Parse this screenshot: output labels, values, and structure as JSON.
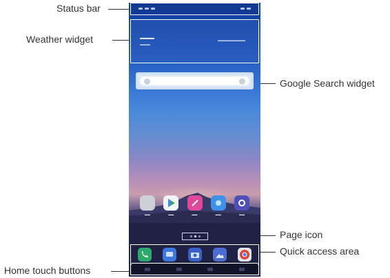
{
  "callouts": {
    "status_bar": "Status bar",
    "weather_widget": "Weather widget",
    "google_search_widget": "Google Search widget",
    "page_icon": "Page icon",
    "quick_access_area": "Quick access area",
    "home_touch_buttons": "Home touch buttons"
  },
  "colors": {
    "line": "#333333",
    "outline": "#ffffff",
    "wallpaper_top": "#0d3a9a",
    "wallpaper_bottom": "#23244a"
  },
  "apps": [
    {
      "icon": "gear-icon",
      "color": "#cfcfd6"
    },
    {
      "icon": "play-store-icon",
      "color": "#f2f4f8"
    },
    {
      "icon": "pen-icon",
      "color": "#e0499a"
    },
    {
      "icon": "camera-icon",
      "color": "#3d92e8"
    },
    {
      "icon": "settings-icon",
      "color": "#4f4fb8"
    }
  ],
  "quick_access": [
    {
      "icon": "phone-icon",
      "color": "#2fa96b"
    },
    {
      "icon": "messages-icon",
      "color": "#3d78e0"
    },
    {
      "icon": "camera-icon",
      "color": "#3960c8"
    },
    {
      "icon": "gallery-icon",
      "color": "#4d6cd2"
    },
    {
      "icon": "chrome-icon",
      "color": "#e4e6ea"
    }
  ]
}
